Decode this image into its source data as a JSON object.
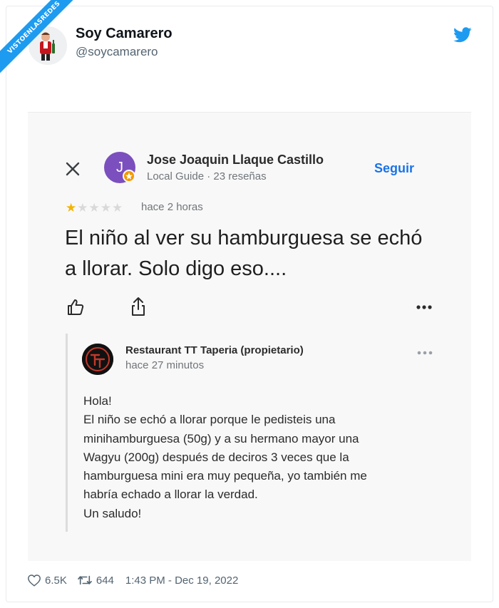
{
  "watermark": {
    "text": "VISTOENLASREDES"
  },
  "tweet": {
    "display_name": "Soy Camarero",
    "handle": "@soycamarero",
    "likes": "6.5K",
    "retweets": "644",
    "timestamp": "1:43 PM - Dec 19, 2022"
  },
  "review": {
    "close_icon": "close-icon",
    "reviewer_initial": "J",
    "reviewer_name": "Jose Joaquin Llaque Castillo",
    "reviewer_meta": "Local Guide · 23 reseñas",
    "follow_label": "Seguir",
    "stars": "★",
    "stars_off": "★★★★",
    "rating": 1,
    "time": "hace 2 horas",
    "text": "El niño al ver su hamburguesa se echó a llorar. Solo digo eso...."
  },
  "reply": {
    "owner_name": "Restaurant TT Taperia (propietario)",
    "owner_time": "hace 27 minutos",
    "lines": [
      "Hola!",
      "El niño se echó a llorar porque le pedisteis una",
      "minihamburguesa (50g) y a su hermano mayor una",
      "Wagyu (200g) después de deciros 3 veces que la",
      "hamburguesa mini era muy pequeña, yo también me",
      "habría echado a llorar la verdad.",
      "Un saludo!"
    ]
  },
  "colors": {
    "twitter_blue": "#1d9bf0",
    "google_blue": "#1a73e8",
    "star_gold": "#f4b400",
    "reviewer_purple": "#7b4fbe"
  }
}
